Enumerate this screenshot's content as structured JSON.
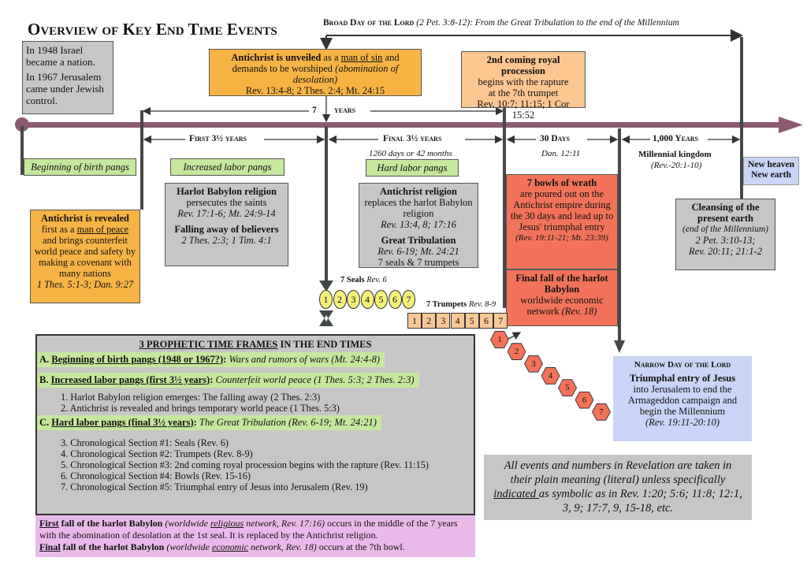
{
  "title": "Overview of Key End Time Events",
  "broad_day": {
    "label": "Broad Day of the Lord",
    "text": "(2 Pet. 3:8-12): From the Great Tribulation to the end of the Millennium"
  },
  "israel_box": {
    "line1": "In 1948 Israel became a nation.",
    "line2": "In 1967 Jerusalem came under Jewish control."
  },
  "unveiled_box": {
    "bold": "Antichrist is unveiled",
    "t1": " as a ",
    "u": "man of sin",
    "t2": " and demands to be worshiped ",
    "i": "(abomination of desolation)",
    "ref": "Rev. 13:4-8; 2 Thes. 2:4; Mt. 24:15"
  },
  "second_coming_box": {
    "bold": "2nd coming royal procession",
    "l2": "begins with the rapture",
    "l3": "at the 7th trumpet",
    "ref": "Rev. 10:7; 11:15; 1 Cor 15:52"
  },
  "seven_years": {
    "num": "7",
    "word": "years"
  },
  "spans": {
    "first": "First 3½ years",
    "final": "Final 3½ years",
    "final_sub": "1260 days or 42 months",
    "days": "30 Days",
    "days_sub": "Dan. 12:11",
    "thousand": "1,000 Years",
    "thousand_sub": "Millennial kingdom",
    "thousand_ref": "(Rev.-20:1-10)"
  },
  "pangs": {
    "beginning": "Beginning of birth pangs",
    "increased": "Increased labor pangs",
    "hard": "Hard labor pangs"
  },
  "new_heaven": {
    "l1": "New heaven",
    "l2": "New earth"
  },
  "revealed_box": {
    "bold": "Antichrist is revealed",
    "t1": "first as a ",
    "u": "man of peace",
    "t2": "and brings counterfeit world peace and safety by making a covenant with many nations",
    "ref": "1 Thes. 5:1-3; Dan. 9:27"
  },
  "harlot_box": {
    "b1": "Harlot Babylon religion",
    "t1": "persecutes the saints",
    "r1": "Rev. 17:1-6; Mt. 24:9-14",
    "b2": "Falling away of believers",
    "r2": "2 Thes. 2:3; 1 Tim. 4:1"
  },
  "ac_religion_box": {
    "b1": "Antichrist religion",
    "t1": " replaces the harlot Babylon religion",
    "r1": "Rev. 13:4, 8; 17:16",
    "b2": "Great Tribulation",
    "r2": "Rev. 6-19; Mt. 24:21",
    "t2": "7 seals & 7 trumpets"
  },
  "bowls_box": {
    "bold": "7 bowls of wrath",
    "text": "are poured out on the Antichrist empire during the 30 days and lead up to Jesus' triumphal entry",
    "ref": "(Rev. 19:11-21; Mt. 23:39)"
  },
  "final_fall_box": {
    "bold": "Final fall of the harlot Babylon",
    "text": "worldwide economic network ",
    "ref": "(Rev. 18)"
  },
  "cleansing_box": {
    "bold": "Cleansing of the present earth",
    "i": "(end of the Millennium)",
    "r1": "2 Pet. 3:10-13;",
    "r2": "Rev. 20:11; 21:1-2"
  },
  "seals": {
    "label": "7 Seals",
    "ref": "Rev. 6",
    "items": [
      "1",
      "2",
      "3",
      "4",
      "5",
      "6",
      "7"
    ],
    "color": "#f5f07a"
  },
  "trumpets": {
    "label": "7 Trumpets",
    "ref": "Rev. 8-9",
    "items": [
      "1",
      "2",
      "3",
      "4",
      "5",
      "6",
      "7"
    ],
    "color": "#f8c998"
  },
  "bowls": {
    "items": [
      "1",
      "2",
      "3",
      "4",
      "5",
      "6",
      "7"
    ],
    "color": "#f2735a"
  },
  "narrow_box": {
    "label": "Narrow Day of the Lord",
    "bold": "Triumphal entry of Jesus",
    "text": "into Jerusalem to end the Armageddon campaign and begin the Millennium",
    "ref": "(Rev. 19:11-20:10)"
  },
  "frames": {
    "heading_u": "3 PROPHETIC TIME FRAMES",
    "heading_rest": " IN THE END TIMES",
    "a": {
      "letter": "A. ",
      "title": "Beginning of birth pangs (1948 or 1967?)",
      "desc": "Wars and rumors of wars (Mt. 24:4-8)"
    },
    "b": {
      "letter": "B. ",
      "title": "Increased labor pangs (first 3½ years)",
      "desc": "Counterfeit world peace (1 Thes. 5:3; 2 Thes. 2:3)"
    },
    "b_items": [
      "1.  Harlot Babylon religion emerges: The falling away (2 Thes. 2:3)",
      "2.  Antichrist is revealed and brings temporary world peace (1 Thes. 5:3)"
    ],
    "c": {
      "letter": "C. ",
      "title": "Hard labor pangs (final 3½ years)",
      "desc": "The Great Tribulation (Rev. 6-19; Mt. 24:21)"
    },
    "c_items": [
      "3.  Chronological Section #1: Seals (Rev. 6)",
      "4.  Chronological Section #2: Trumpets (Rev. 8-9)",
      "5.  Chronological Section #3: 2nd coming royal procession begins with the rapture (Rev. 11:15)",
      "6.  Chronological Section #4: Bowls (Rev. 15-16)",
      "7.  Chronological Section #5: Triumphal entry of Jesus into Jerusalem (Rev. 19)"
    ]
  },
  "falls": {
    "first_u": "First",
    "first_b": " fall of the harlot Babylon ",
    "first_i1": "(worldwide ",
    "first_iu": "religious",
    "first_i2": " network, Rev. 17:16)",
    "first_t": " occurs in the middle of the 7 years with the abomination of desolation at the 1st seal. It is replaced by the Antichrist religion.",
    "final_u": "Final",
    "final_b": " fall of the harlot Babylon ",
    "final_i1": "(worldwide ",
    "final_iu": "economic",
    "final_i2": " network, Rev. 18)",
    "final_t": " occurs at the 7th  bowl."
  },
  "note": {
    "t1": "All events and numbers in Revelation are taken in their plain meaning (literal) unless specifically ",
    "u": "indicated ",
    "t2": "as symbolic as in Rev. 1:20; 5:6; 11:8; 12:1, 3, 9; 17:7, 9, 15-18, etc."
  },
  "colors": {
    "timeline": "#8a5a70",
    "connector": "#474747",
    "orange": "#f8b345",
    "gray": "#c6c6c6",
    "green": "#c5e79e",
    "red": "#f2735a",
    "blue": "#c9d5f6",
    "purple": "#e9b9ea"
  }
}
